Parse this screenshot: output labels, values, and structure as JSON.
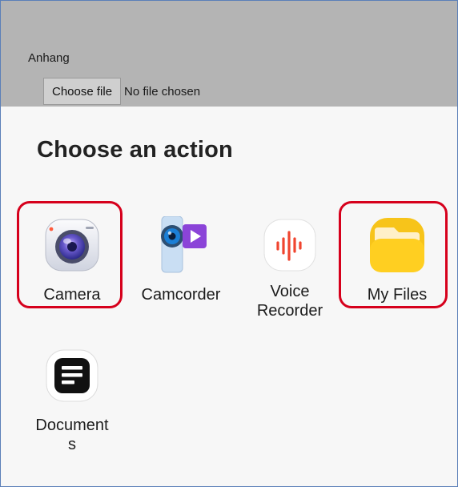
{
  "form": {
    "attachment_label": "Anhang",
    "choose_file_label": "Choose file",
    "file_status": "No file chosen"
  },
  "sheet": {
    "title": "Choose an action",
    "apps": [
      {
        "label": "Camera",
        "icon": "camera-icon",
        "highlighted": true
      },
      {
        "label": "Camcorder",
        "icon": "camcorder-icon",
        "highlighted": false
      },
      {
        "label": "Voice\nRecorder",
        "icon": "voice-recorder-icon",
        "highlighted": false
      },
      {
        "label": "My Files",
        "icon": "folder-icon",
        "highlighted": true
      },
      {
        "label": "Document\ns",
        "icon": "documents-icon",
        "highlighted": false
      }
    ]
  },
  "colors": {
    "highlight": "#d6001c",
    "sheet_background": "#f7f7f7",
    "dim_overlay": "#b4b4b4"
  }
}
